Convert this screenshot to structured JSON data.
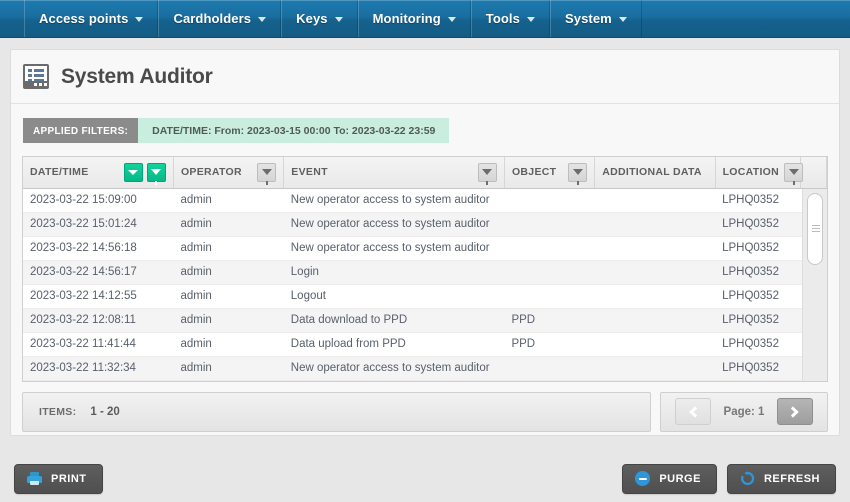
{
  "menu": {
    "items": [
      {
        "label": "Access points",
        "icon": "chevron-down-icon"
      },
      {
        "label": "Cardholders",
        "icon": "chevron-down-icon"
      },
      {
        "label": "Keys",
        "icon": "chevron-down-icon"
      },
      {
        "label": "Monitoring",
        "icon": "chevron-down-icon"
      },
      {
        "label": "Tools",
        "icon": "chevron-down-icon"
      },
      {
        "label": "System",
        "icon": "chevron-down-icon"
      }
    ]
  },
  "page": {
    "title": "System Auditor",
    "title_icon": "auditor-report-icon"
  },
  "filters": {
    "label": "APPLIED FILTERS:",
    "value": "DATE/TIME: From: 2023-03-15 00:00 To: 2023-03-22 23:59",
    "chip_bg": "#c9eee0",
    "label_bg": "#8b8b8b"
  },
  "table": {
    "columns": [
      {
        "key": "datetime",
        "label": "DATE/TIME",
        "sort": "desc",
        "filter_active": true
      },
      {
        "key": "operator",
        "label": "OPERATOR",
        "sort": null,
        "filter_active": false
      },
      {
        "key": "event",
        "label": "EVENT",
        "sort": null,
        "filter_active": false
      },
      {
        "key": "object",
        "label": "OBJECT",
        "sort": null,
        "filter_active": false
      },
      {
        "key": "additional",
        "label": "ADDITIONAL DATA",
        "sort": null,
        "filter_active": null
      },
      {
        "key": "location",
        "label": "LOCATION",
        "sort": null,
        "filter_active": false
      }
    ],
    "rows": [
      {
        "datetime": "2023-03-22 15:09:00",
        "operator": "admin",
        "event": "New operator access to system auditor",
        "object": "",
        "additional": "",
        "location": "LPHQ0352"
      },
      {
        "datetime": "2023-03-22 15:01:24",
        "operator": "admin",
        "event": "New operator access to system auditor",
        "object": "",
        "additional": "",
        "location": "LPHQ0352"
      },
      {
        "datetime": "2023-03-22 14:56:18",
        "operator": "admin",
        "event": "New operator access to system auditor",
        "object": "",
        "additional": "",
        "location": "LPHQ0352"
      },
      {
        "datetime": "2023-03-22 14:56:17",
        "operator": "admin",
        "event": "Login",
        "object": "",
        "additional": "",
        "location": "LPHQ0352"
      },
      {
        "datetime": "2023-03-22 14:12:55",
        "operator": "admin",
        "event": "Logout",
        "object": "",
        "additional": "",
        "location": "LPHQ0352"
      },
      {
        "datetime": "2023-03-22 12:08:11",
        "operator": "admin",
        "event": "Data download to PPD",
        "object": "PPD",
        "additional": "",
        "location": "LPHQ0352"
      },
      {
        "datetime": "2023-03-22 11:41:44",
        "operator": "admin",
        "event": "Data upload from PPD",
        "object": "PPD",
        "additional": "",
        "location": "LPHQ0352"
      },
      {
        "datetime": "2023-03-22 11:32:34",
        "operator": "admin",
        "event": "New operator access to system auditor",
        "object": "",
        "additional": "",
        "location": "LPHQ0352"
      }
    ]
  },
  "pager": {
    "items_label": "ITEMS:",
    "items_value": "1 - 20",
    "page_label": "Page: 1",
    "prev_icon": "chevron-left-icon",
    "next_icon": "chevron-right-icon",
    "prev_enabled": false,
    "next_enabled": true
  },
  "actions": {
    "print": {
      "label": "PRINT",
      "icon": "printer-icon"
    },
    "purge": {
      "label": "PURGE",
      "icon": "minus-circle-icon"
    },
    "refresh": {
      "label": "REFRESH",
      "icon": "refresh-icon"
    }
  },
  "colors": {
    "menu_blue": "#1a6e9f",
    "accent_green": "#05b988",
    "icon_blue": "#2f96d8",
    "page_bg": "#e7e7e7"
  }
}
